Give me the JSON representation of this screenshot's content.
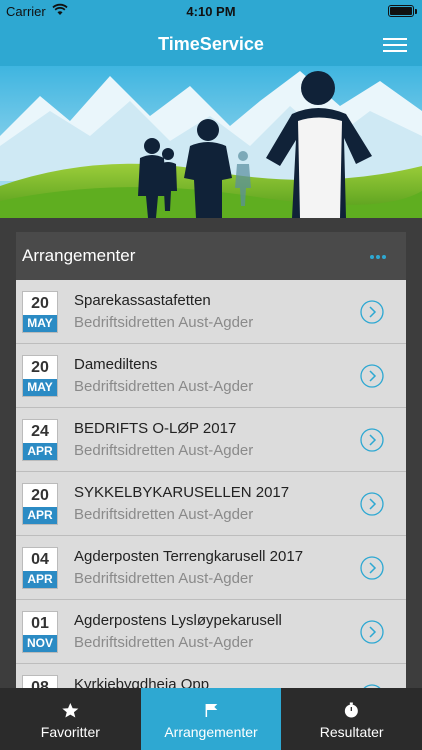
{
  "status": {
    "carrier": "Carrier",
    "time": "4:10 PM"
  },
  "app": {
    "title": "TimeService"
  },
  "events": {
    "title": "Arrangementer",
    "items": [
      {
        "day": "20",
        "month": "MAY",
        "name": "Sparekassastafetten",
        "org": "Bedriftsidretten Aust-Agder"
      },
      {
        "day": "20",
        "month": "MAY",
        "name": "Damediltens",
        "org": "Bedriftsidretten Aust-Agder"
      },
      {
        "day": "24",
        "month": "APR",
        "name": "BEDRIFTS O-LØP 2017",
        "org": "Bedriftsidretten Aust-Agder"
      },
      {
        "day": "20",
        "month": "APR",
        "name": "SYKKELBYKARUSELLEN 2017",
        "org": "Bedriftsidretten Aust-Agder"
      },
      {
        "day": "04",
        "month": "APR",
        "name": "Agderposten Terrengkarusell 2017",
        "org": "Bedriftsidretten Aust-Agder"
      },
      {
        "day": "01",
        "month": "NOV",
        "name": "Agderpostens Lysløypekarusell",
        "org": "Bedriftsidretten Aust-Agder"
      },
      {
        "day": "08",
        "month": "",
        "name": "Kyrkjebygdheia Opp",
        "org": ""
      }
    ]
  },
  "tabs": [
    {
      "label": "Favoritter",
      "icon": "star-icon"
    },
    {
      "label": "Arrangementer",
      "icon": "flag-icon"
    },
    {
      "label": "Resultater",
      "icon": "stopwatch-icon"
    }
  ],
  "colors": {
    "accent": "#2ea8d2",
    "month_badge": "#2b8bc4",
    "tab_bar": "#2b2b2b"
  }
}
